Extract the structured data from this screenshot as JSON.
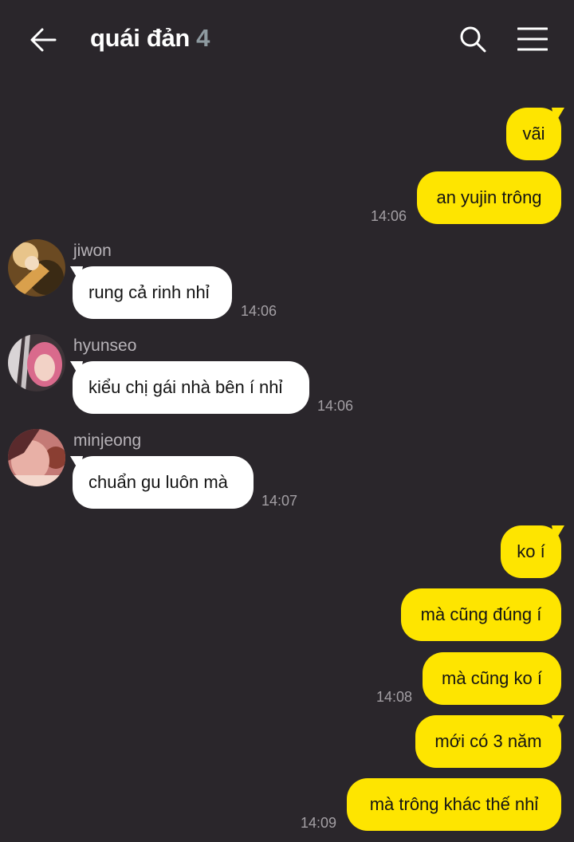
{
  "header": {
    "title": "quái đản",
    "member_count": "4",
    "back_icon": "arrow-left-icon",
    "search_icon": "search-icon",
    "menu_icon": "hamburger-menu-icon"
  },
  "colors": {
    "background": "#2a262b",
    "my_bubble": "#fee500",
    "other_bubble": "#ffffff",
    "timestamp": "#a39fa4",
    "member_count": "#8e9aa0"
  },
  "messages": {
    "m1": {
      "text": "vãi"
    },
    "m2": {
      "text": "an yujin trông",
      "time": "14:06"
    },
    "m3": {
      "sender": "jiwon",
      "text": "rung cả rinh nhỉ",
      "time": "14:06"
    },
    "m4": {
      "sender": "hyunseo",
      "text": "kiểu chị gái nhà bên í nhỉ",
      "time": "14:06"
    },
    "m5": {
      "sender": "minjeong",
      "text": "chuẩn gu luôn mà",
      "time": "14:07"
    },
    "m6": {
      "text": "ko í"
    },
    "m7": {
      "text": "mà cũng đúng í"
    },
    "m8": {
      "text": "mà cũng ko í",
      "time": "14:08"
    },
    "m9": {
      "text": "mới có 3 năm"
    },
    "m10": {
      "text": "mà trông khác thế nhỉ",
      "time": "14:09"
    }
  }
}
